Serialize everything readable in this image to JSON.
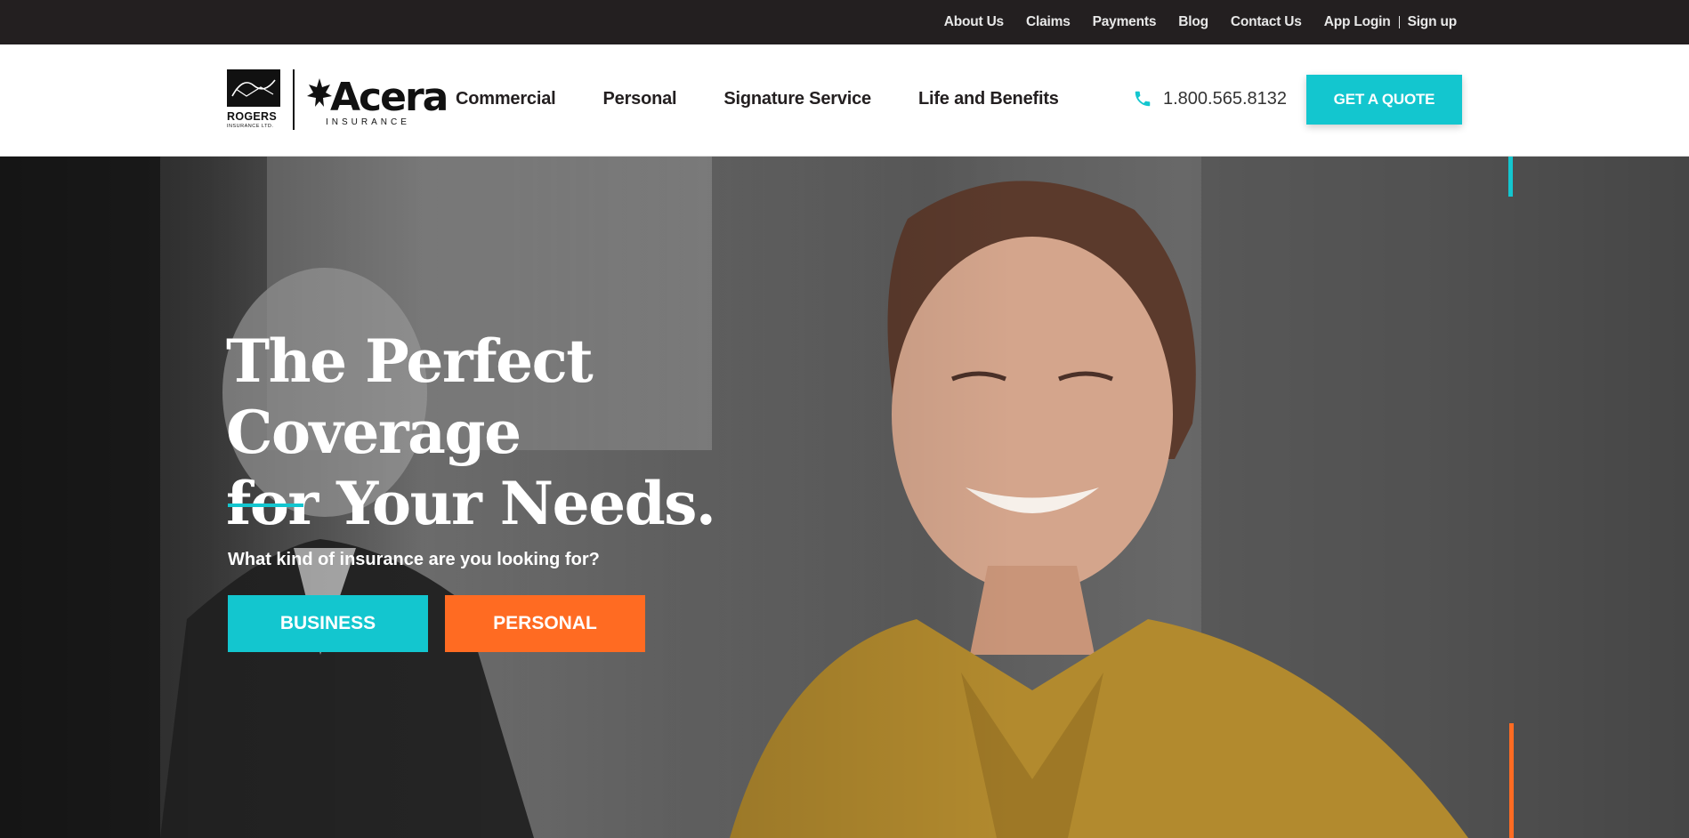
{
  "topbar": {
    "links": [
      "About Us",
      "Claims",
      "Payments",
      "Blog",
      "Contact Us",
      "App Login"
    ],
    "signup": "Sign up"
  },
  "header": {
    "logo": {
      "rogers": "ROGERS",
      "rogers_sub": "INSURANCE LTD.",
      "acera": "Acera",
      "acera_sub": "INSURANCE"
    },
    "nav": [
      "Commercial",
      "Personal",
      "Signature Service",
      "Life and Benefits"
    ],
    "phone": "1.800.565.8132",
    "quote_button": "GET A QUOTE"
  },
  "hero": {
    "title_line1": "The Perfect Coverage",
    "title_line2": "for Your Needs.",
    "question": "What kind of insurance are you looking for?",
    "business_button": "BUSINESS",
    "personal_button": "PERSONAL"
  },
  "colors": {
    "teal": "#13c6cf",
    "orange": "#ff6b22",
    "topbar_bg": "#231f20"
  },
  "icons": {
    "phone": "phone-icon",
    "leaf": "maple-leaf-icon"
  }
}
